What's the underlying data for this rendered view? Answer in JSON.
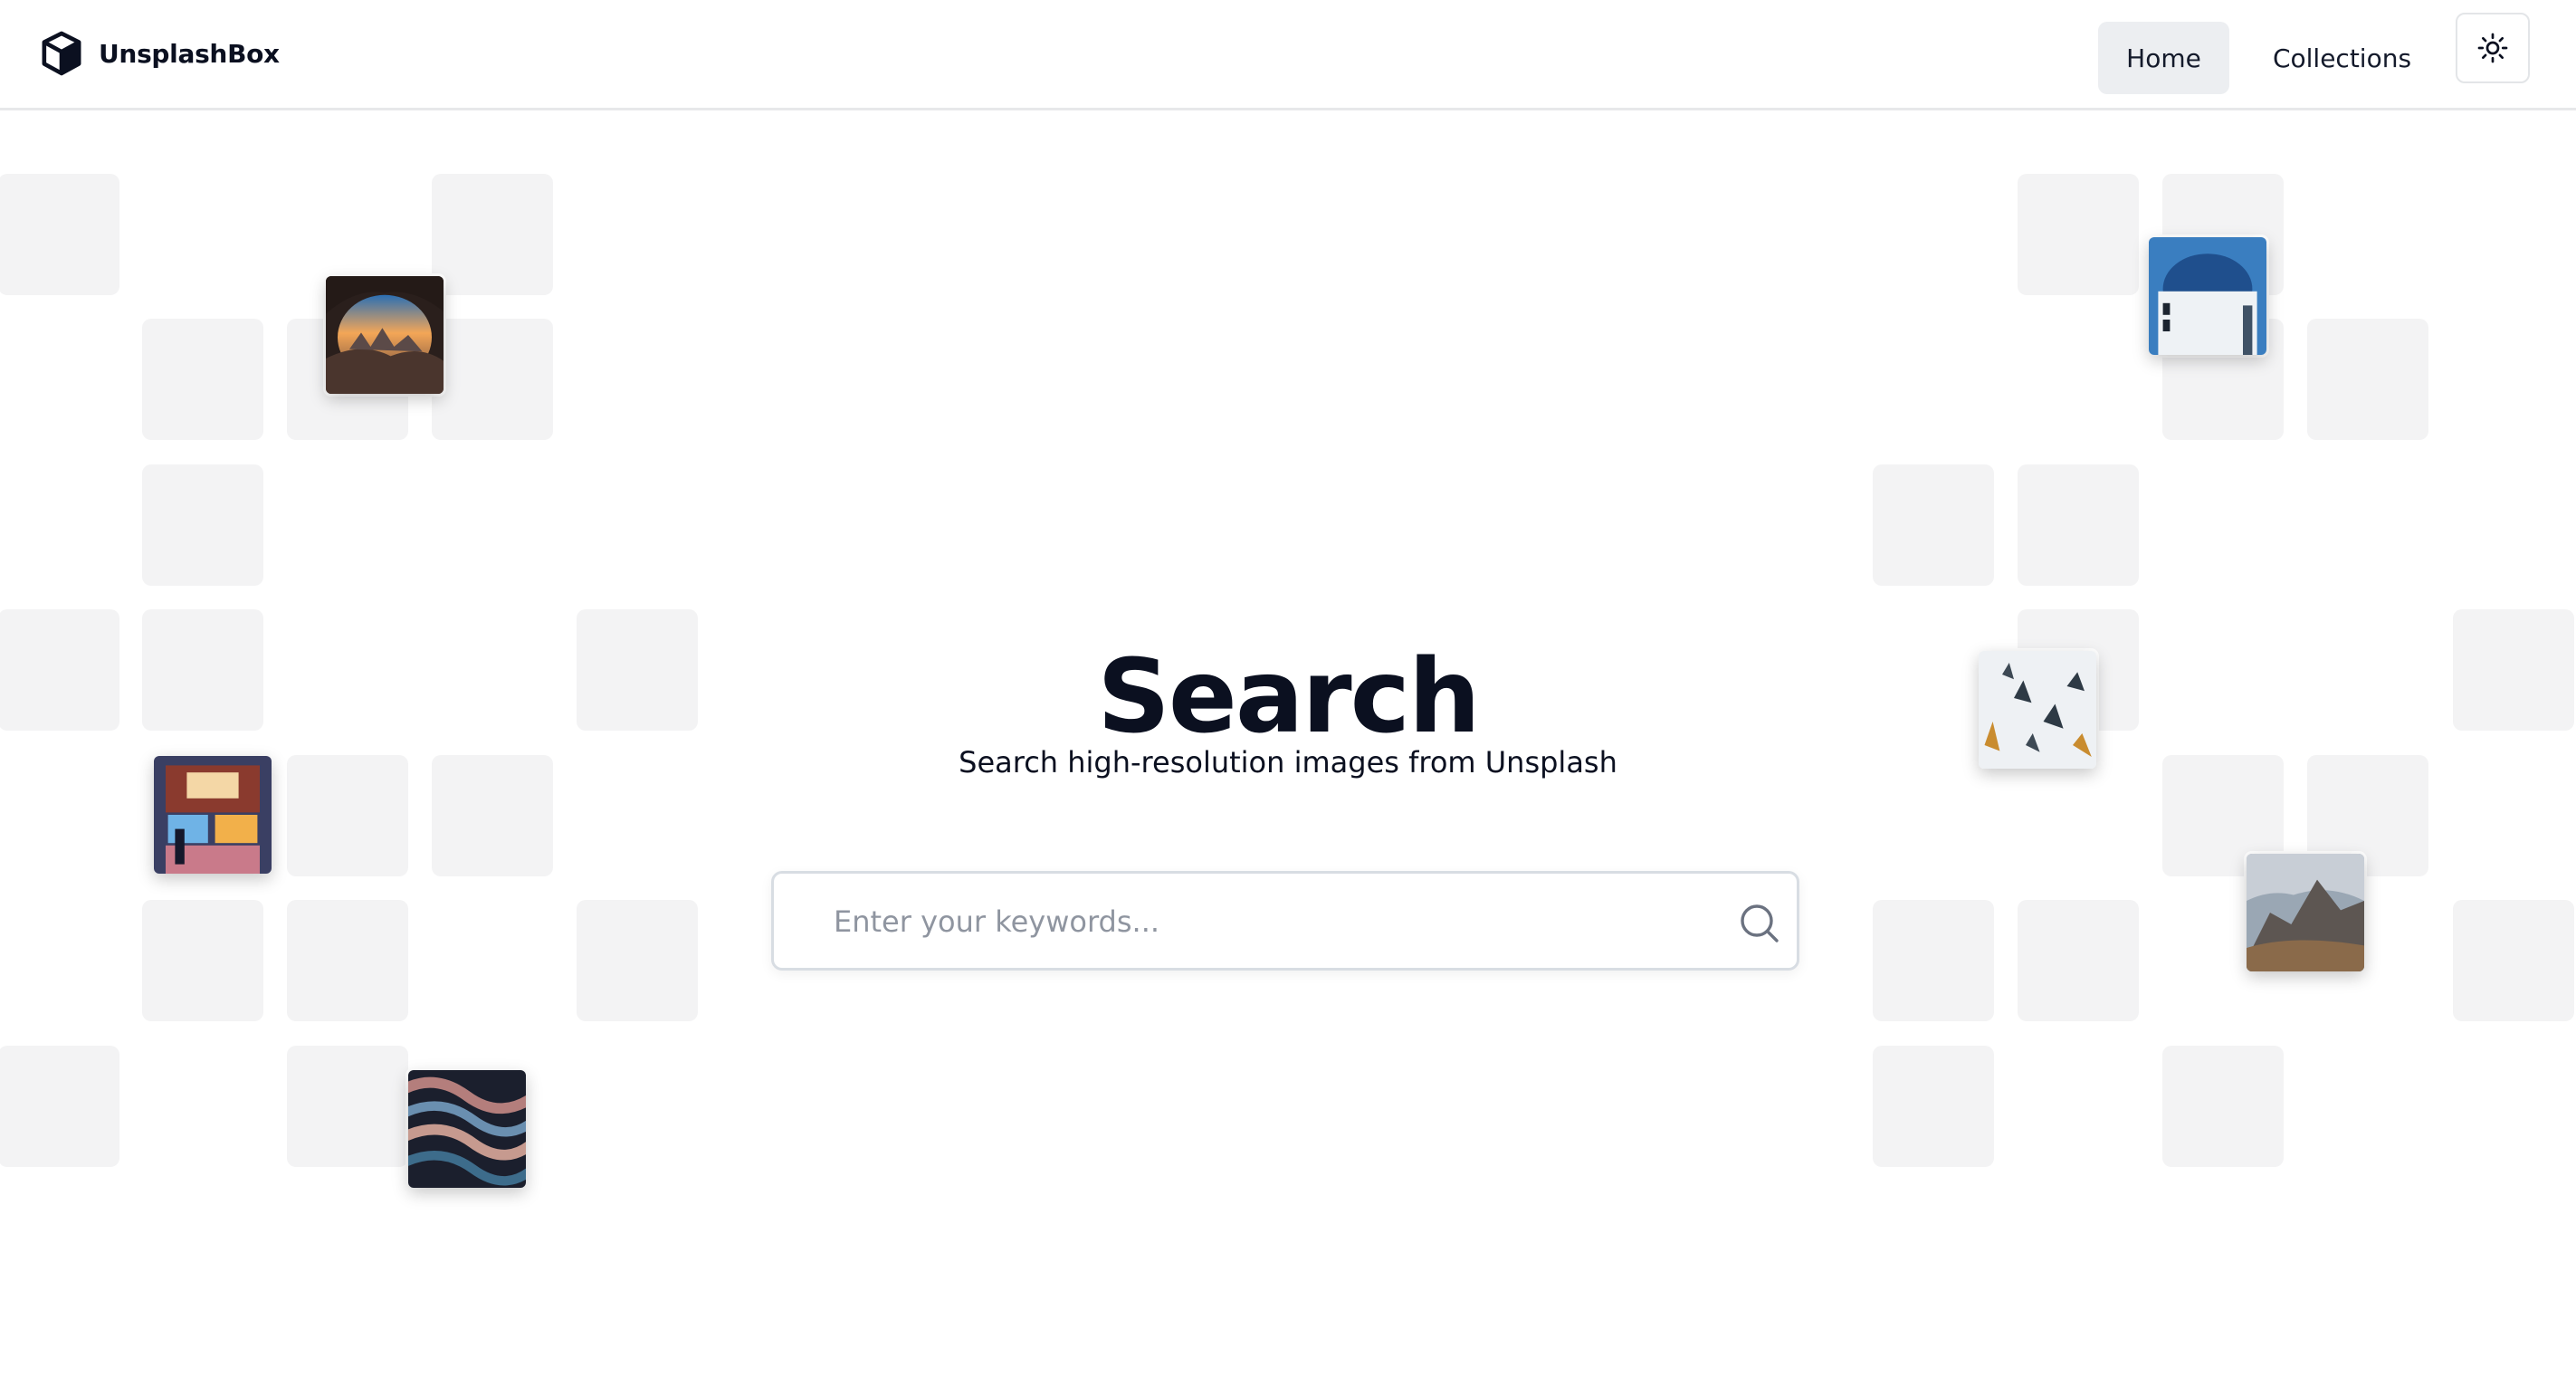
{
  "header": {
    "brand_name": "UnsplashBox",
    "brand_icon": "cube-icon",
    "nav": {
      "home_label": "Home",
      "collections_label": "Collections"
    },
    "theme_toggle_icon": "sun-icon"
  },
  "hero": {
    "title": "Search",
    "subtitle": "Search high-resolution images from Unsplash"
  },
  "search": {
    "placeholder": "Enter your keywords...",
    "value": "",
    "icon": "search-icon"
  },
  "colors": {
    "text": "#0b1020",
    "nav_active_bg": "#eceef1",
    "tile_bg": "#f3f3f4",
    "border": "#e7e8ea"
  }
}
